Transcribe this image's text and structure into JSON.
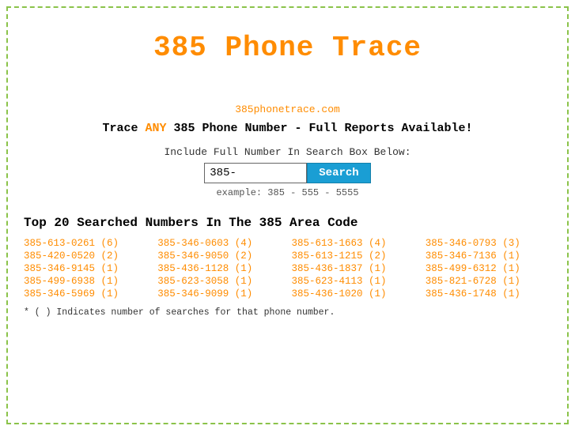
{
  "page": {
    "title": "385 Phone Trace",
    "site_url": "385phonetrace.com",
    "tagline_start": "Trace ",
    "tagline_any": "ANY",
    "tagline_end": " 385 Phone Number - Full Reports Available!",
    "search_label": "Include Full Number In Search Box Below:",
    "search_placeholder": "385-",
    "search_button_label": "Search",
    "search_example": "example: 385 - 555 - 5555",
    "top_section_title": "Top 20 Searched Numbers In The 385 Area Code",
    "footnote": "* ( ) Indicates number of searches for that phone number.",
    "numbers": [
      [
        "385-613-0261 (6)",
        "385-346-0603 (4)",
        "385-613-1663 (4)",
        "385-346-0793 (3)"
      ],
      [
        "385-420-0520 (2)",
        "385-346-9050 (2)",
        "385-613-1215 (2)",
        "385-346-7136 (1)"
      ],
      [
        "385-346-9145 (1)",
        "385-436-1128 (1)",
        "385-436-1837 (1)",
        "385-499-6312 (1)"
      ],
      [
        "385-499-6938 (1)",
        "385-623-3058 (1)",
        "385-623-4113 (1)",
        "385-821-6728 (1)"
      ],
      [
        "385-346-5969 (1)",
        "385-346-9099 (1)",
        "385-436-1020 (1)",
        "385-436-1748 (1)"
      ]
    ]
  }
}
